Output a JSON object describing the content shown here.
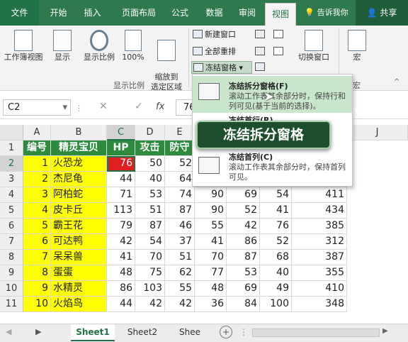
{
  "tabs": [
    "文件",
    "开始",
    "插入",
    "页面布局",
    "公式",
    "数据",
    "审阅",
    "视图"
  ],
  "tell_me": "告诉我你",
  "share": "共享",
  "ribbon": {
    "workbook_view": "工作簿视图",
    "show": "显示",
    "zoom": "显示比例",
    "zoom100": "100%",
    "zoom_selection": "缩放到\n选定区域",
    "group_zoom": "显示比例",
    "new_window": "新建窗口",
    "arrange_all": "全部重排",
    "freeze_panes": "冻结窗格",
    "switch_window": "切换窗口",
    "macros": "宏",
    "macros_group": "宏"
  },
  "formula_bar": {
    "name_box": "C2",
    "fx": "fx",
    "value": "76"
  },
  "dropdown": {
    "item1_title": "冻结拆分窗格(F)",
    "item1_desc": "滚动工作表其余部分时，保持行和列可见(基于当前的选择)。",
    "item2_title": "冻结首行(R)",
    "item3_title": "冻结首列(C)",
    "item3_desc": "滚动工作表其余部分时，保持首列可见。"
  },
  "tooltip": "冻结拆分窗格",
  "columns": [
    "A",
    "B",
    "C",
    "D",
    "E",
    "F",
    "G",
    "H",
    "I",
    "J"
  ],
  "rows": [
    {
      "n": "1",
      "a": "编号",
      "b": "精灵宝贝",
      "c": "HP",
      "d": "攻击",
      "e": "防守",
      "f": "",
      "g": "",
      "h": "",
      "i": ""
    },
    {
      "n": "2",
      "a": "1",
      "b": "火恐龙",
      "c": "76",
      "d": "50",
      "e": "52",
      "f": "",
      "g": "",
      "h": "",
      "i": ""
    },
    {
      "n": "3",
      "a": "2",
      "b": "杰尼龟",
      "c": "44",
      "d": "40",
      "e": "64",
      "f": "",
      "g": "",
      "h": "",
      "i": ""
    },
    {
      "n": "4",
      "a": "3",
      "b": "阿柏蛇",
      "c": "71",
      "d": "53",
      "e": "74",
      "f": "90",
      "g": "69",
      "h": "54",
      "i": "411"
    },
    {
      "n": "5",
      "a": "4",
      "b": "皮卡丘",
      "c": "113",
      "d": "51",
      "e": "87",
      "f": "90",
      "g": "52",
      "h": "41",
      "i": "434"
    },
    {
      "n": "6",
      "a": "5",
      "b": "霸王花",
      "c": "79",
      "d": "87",
      "e": "46",
      "f": "55",
      "g": "42",
      "h": "76",
      "i": "385"
    },
    {
      "n": "7",
      "a": "6",
      "b": "可达鸭",
      "c": "42",
      "d": "54",
      "e": "37",
      "f": "41",
      "g": "86",
      "h": "52",
      "i": "312"
    },
    {
      "n": "8",
      "a": "7",
      "b": "呆呆兽",
      "c": "41",
      "d": "70",
      "e": "51",
      "f": "70",
      "g": "87",
      "h": "68",
      "i": "387"
    },
    {
      "n": "9",
      "a": "8",
      "b": "蛋蛋",
      "c": "48",
      "d": "75",
      "e": "62",
      "f": "77",
      "g": "53",
      "h": "40",
      "i": "355"
    },
    {
      "n": "10",
      "a": "9",
      "b": "水精灵",
      "c": "86",
      "d": "103",
      "e": "55",
      "f": "48",
      "g": "69",
      "h": "49",
      "i": "410"
    },
    {
      "n": "11",
      "a": "10",
      "b": "火焰鸟",
      "c": "44",
      "d": "42",
      "e": "42",
      "f": "36",
      "g": "84",
      "h": "100",
      "i": "348"
    }
  ],
  "sheets": [
    "Sheet1",
    "Sheet2",
    "Shee"
  ],
  "colors": {
    "excel_green": "#217346",
    "yellow": "#ffff00",
    "red": "#e02020",
    "header_green": "#2e8b3e",
    "tooltip_bg": "#1d4f2c"
  }
}
